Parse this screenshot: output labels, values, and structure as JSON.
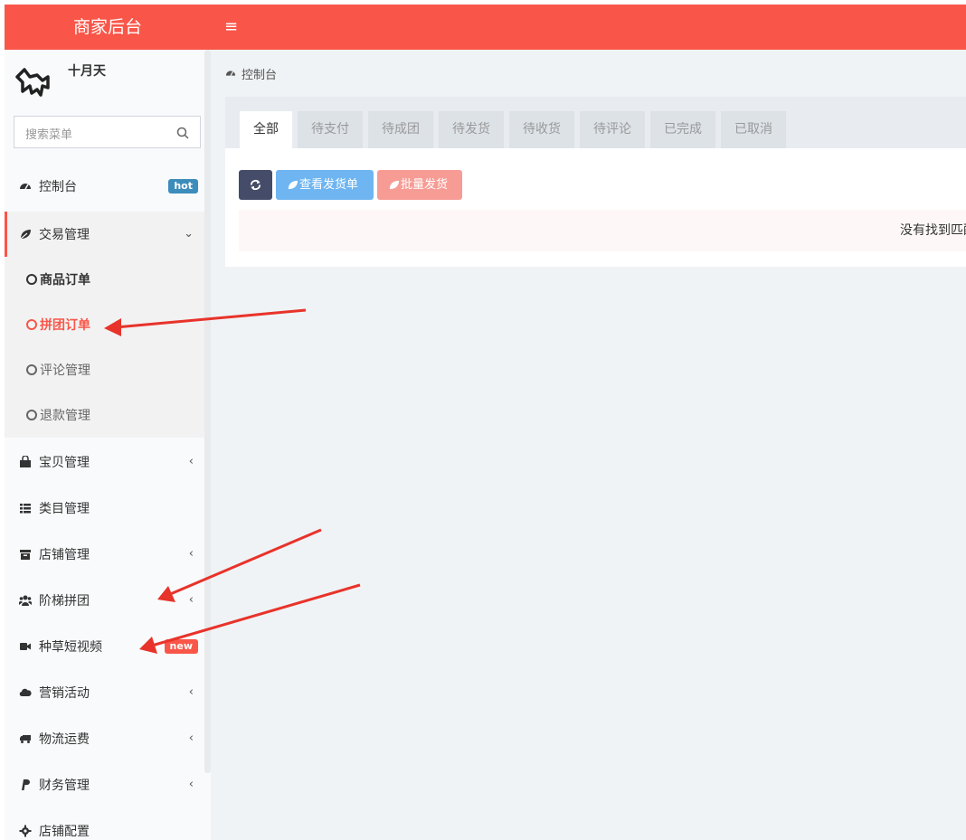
{
  "header": {
    "brand": "商家后台",
    "menu_toggle_icon": "hamburger-icon",
    "color": "#f95649"
  },
  "user": {
    "name": "十月天",
    "logo_icon": "dog-logo-icon"
  },
  "search": {
    "placeholder": "搜索菜单"
  },
  "sidebar": {
    "items": [
      {
        "label": "控制台",
        "icon": "dashboard-icon",
        "badge": "hot",
        "badge_color": "#3c8dbc"
      },
      {
        "label": "交易管理",
        "icon": "leaf-icon",
        "expanded": true
      },
      {
        "label": "宝贝管理",
        "icon": "shopping-bag-icon"
      },
      {
        "label": "类目管理",
        "icon": "list-icon"
      },
      {
        "label": "店铺管理",
        "icon": "archive-icon"
      },
      {
        "label": "阶梯拼团",
        "icon": "users-icon"
      },
      {
        "label": "种草短视频",
        "icon": "video-icon",
        "badge": "new",
        "badge_color": "#f95649"
      },
      {
        "label": "营销活动",
        "icon": "cloud-icon"
      },
      {
        "label": "物流运费",
        "icon": "truck-icon"
      },
      {
        "label": "财务管理",
        "icon": "paypal-icon"
      },
      {
        "label": "店铺配置",
        "icon": "gear-icon"
      }
    ],
    "submenu": [
      {
        "label": "商品订单",
        "active": false
      },
      {
        "label": "拼团订单",
        "active": true
      },
      {
        "label": "评论管理",
        "active": false
      },
      {
        "label": "退款管理",
        "active": false
      }
    ]
  },
  "breadcrumb": {
    "label": "控制台",
    "icon": "dashboard-icon"
  },
  "tabs": [
    {
      "label": "全部",
      "active": true
    },
    {
      "label": "待支付"
    },
    {
      "label": "待成团"
    },
    {
      "label": "待发货"
    },
    {
      "label": "待收货"
    },
    {
      "label": "待评论"
    },
    {
      "label": "已完成"
    },
    {
      "label": "已取消"
    }
  ],
  "toolbar": {
    "refresh_icon": "refresh-icon",
    "view_shipping_label": "查看发货单",
    "batch_ship_label": "批量发货",
    "colors": {
      "refresh": "#444c69",
      "view": "#6eb5f1",
      "batch": "#f79c95"
    }
  },
  "table": {
    "empty_text": "没有找到匹配的记录"
  },
  "active_color": "#f95649"
}
